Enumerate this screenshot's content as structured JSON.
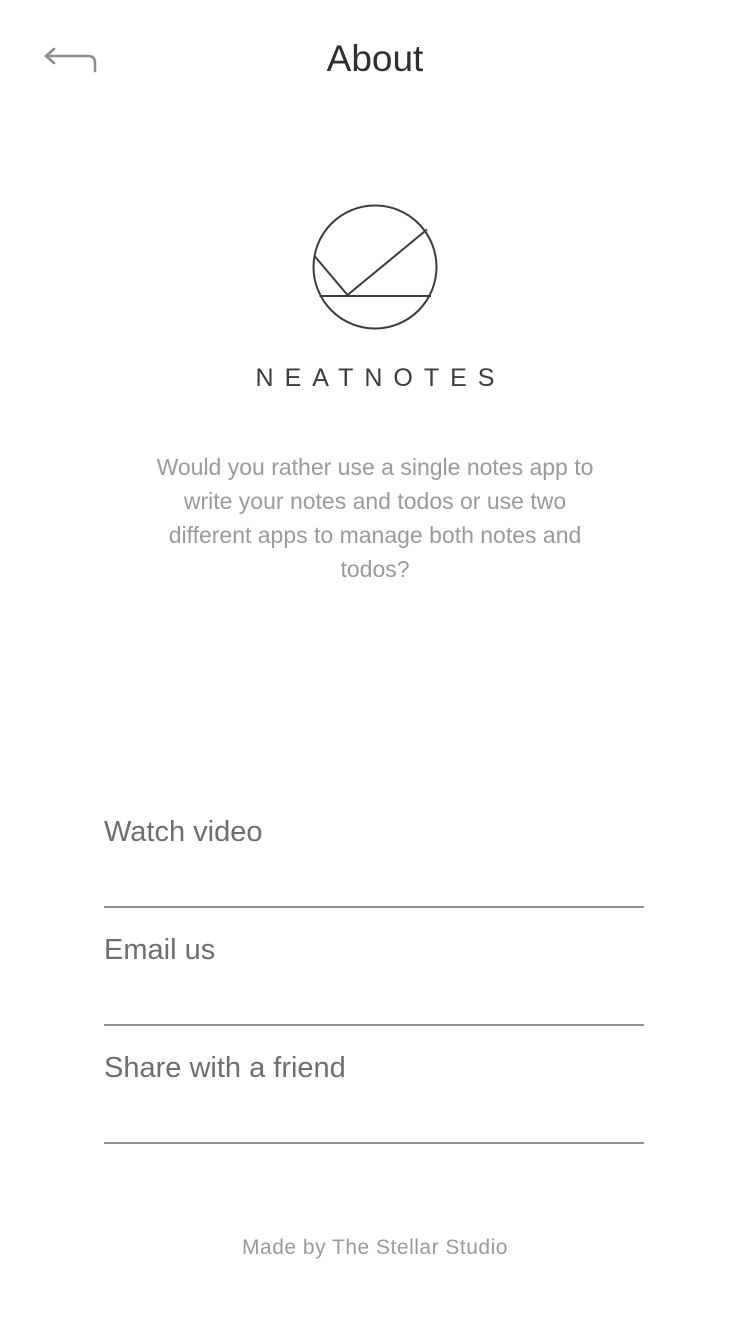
{
  "header": {
    "title": "About",
    "back_icon": "return-arrow-icon"
  },
  "brand": {
    "logo_icon": "check-circle-logo-icon",
    "name": "NEATNOTES"
  },
  "description": "Would you rather use a single notes app to write your notes and todos or use two different apps to manage both notes and todos?",
  "menu": {
    "items": [
      {
        "label": "Watch video"
      },
      {
        "label": "Email us"
      },
      {
        "label": "Share with a friend"
      }
    ]
  },
  "footer": {
    "credit": "Made by The Stellar Studio"
  },
  "colors": {
    "title": "#2f2f31",
    "body_text": "#9a9a9c",
    "menu_text": "#6e6e70",
    "divider": "#8f8f91",
    "icon": "#8e8e90"
  }
}
